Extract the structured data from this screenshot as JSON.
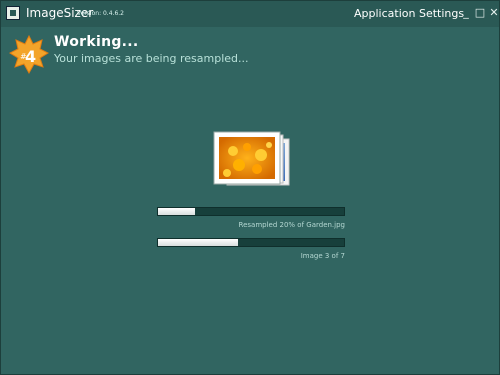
{
  "window": {
    "app_name": "ImageSizer",
    "version": "Version: 0.4.6.2",
    "settings_label": "Application Settings",
    "controls": {
      "minimize": "_",
      "maximize": "□",
      "close": "✕"
    }
  },
  "step": {
    "badge_hash": "#",
    "badge_number": "4",
    "title": "Working...",
    "subtitle": "Your images are being resampled..."
  },
  "progress": {
    "current_file": {
      "percent": 20,
      "label": "Resampled 20% of Garden.jpg"
    },
    "overall": {
      "current": 3,
      "total": 7,
      "label": "Image 3 of 7"
    }
  },
  "icons": {
    "badge": "star-badge-icon",
    "images": "image-stack-icon"
  },
  "colors": {
    "background": "#316561",
    "progress_fill": "#ffffff",
    "progress_track": "#173f3b",
    "badge": "#f3a42a"
  }
}
